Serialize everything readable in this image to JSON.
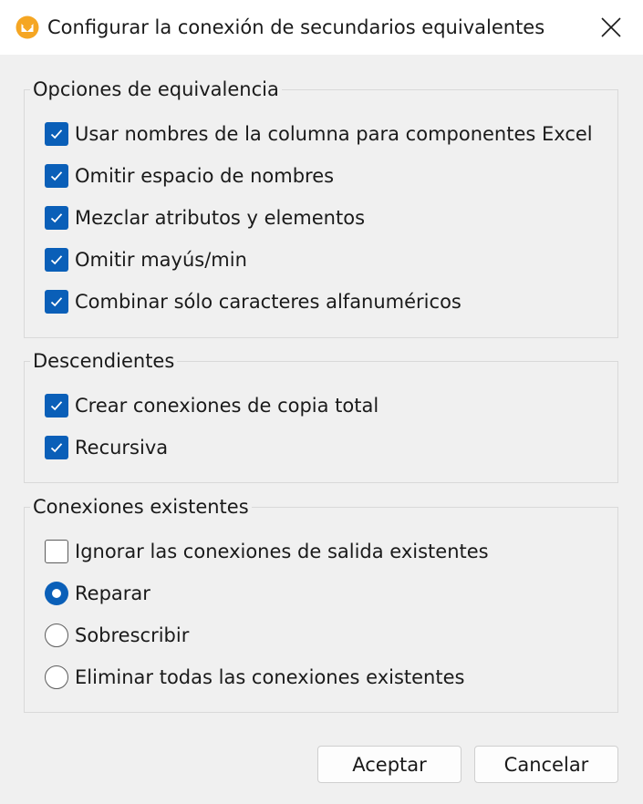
{
  "window": {
    "title": "Configurar la conexión de secundarios equivalentes"
  },
  "colors": {
    "accent": "#0a5fb8",
    "icon_orange": "#f5a623"
  },
  "groups": {
    "matching": {
      "legend": "Opciones de equivalencia",
      "options": [
        {
          "label": "Usar nombres de la columna para componentes Excel",
          "checked": true
        },
        {
          "label": "Omitir espacio de nombres",
          "checked": true
        },
        {
          "label": "Mezclar atributos y elementos",
          "checked": true
        },
        {
          "label": "Omitir mayús/min",
          "checked": true
        },
        {
          "label": "Combinar sólo caracteres alfanuméricos",
          "checked": true
        }
      ]
    },
    "descendants": {
      "legend": "Descendientes",
      "options": [
        {
          "label": "Crear conexiones de copia total",
          "checked": true
        },
        {
          "label": "Recursiva",
          "checked": true
        }
      ]
    },
    "existing": {
      "legend": "Conexiones existentes",
      "ignore_option": {
        "label": "Ignorar las conexiones de salida existentes",
        "checked": false
      },
      "radio_options": [
        {
          "label": "Reparar",
          "selected": true
        },
        {
          "label": "Sobrescribir",
          "selected": false
        },
        {
          "label": "Eliminar todas las conexiones existentes",
          "selected": false
        }
      ]
    }
  },
  "buttons": {
    "ok": "Aceptar",
    "cancel": "Cancelar"
  },
  "icons": {
    "app": "mapforce-app-icon",
    "close": "close-icon",
    "check": "checkmark-icon"
  }
}
